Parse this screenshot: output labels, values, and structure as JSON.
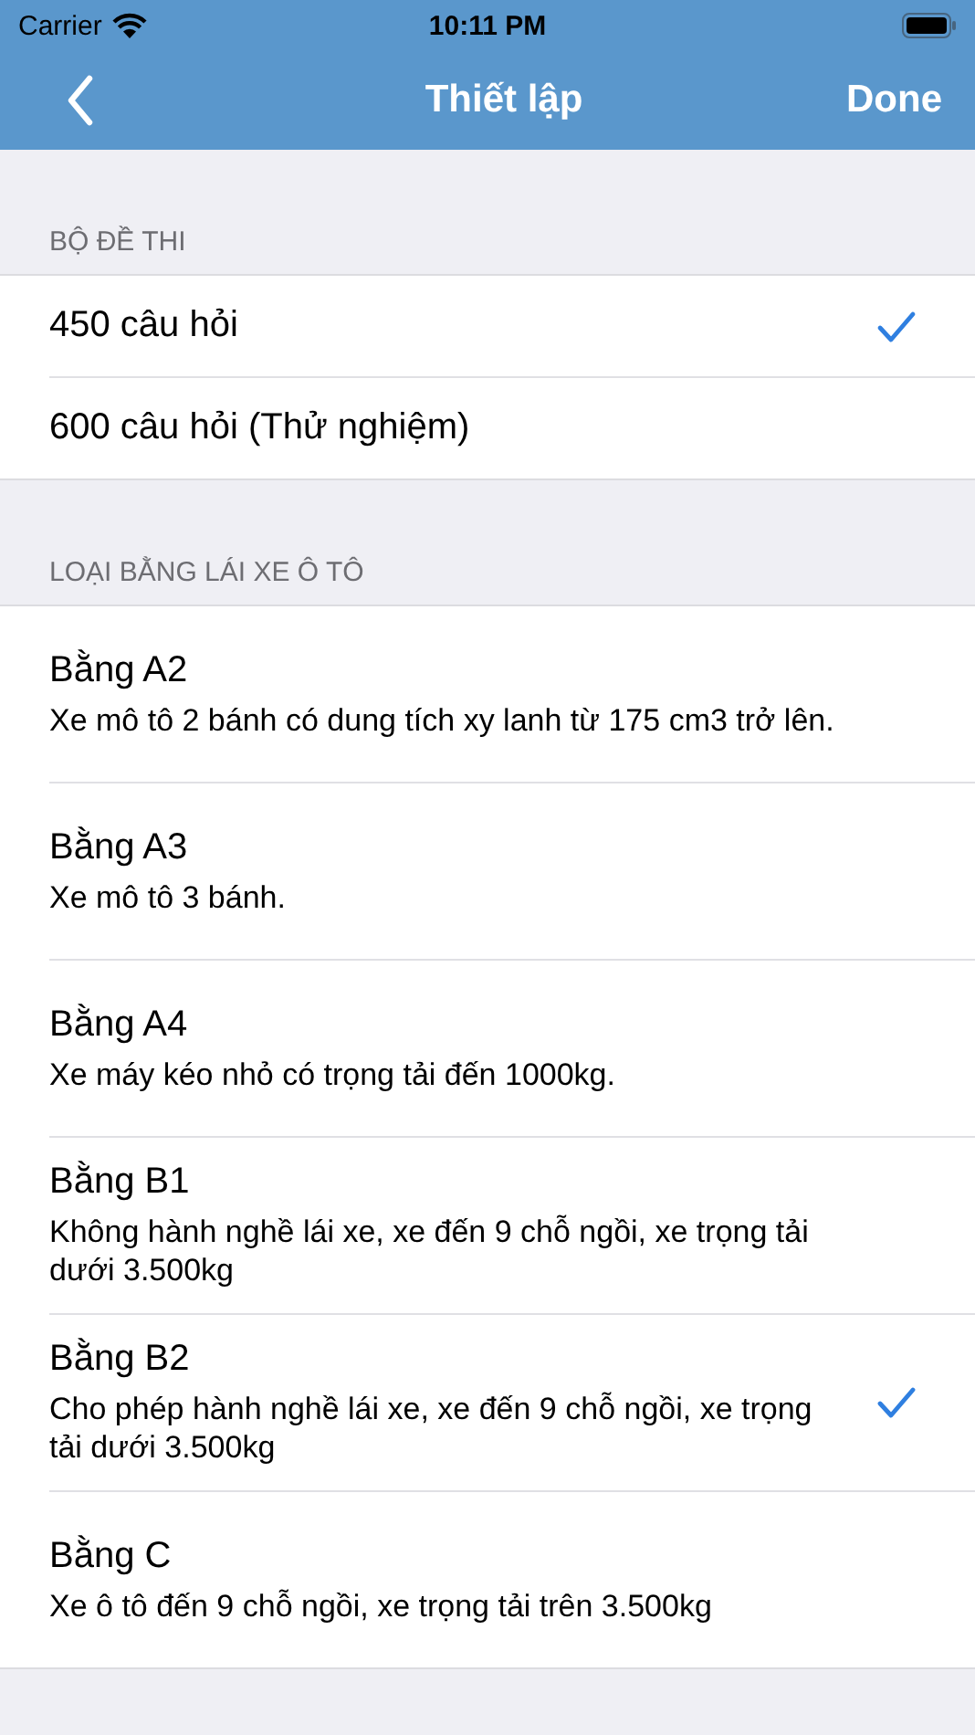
{
  "status_bar": {
    "carrier": "Carrier",
    "time": "10:11 PM"
  },
  "nav": {
    "title": "Thiết lập",
    "done": "Done"
  },
  "sections": [
    {
      "header": "BỘ ĐỀ THI",
      "items": [
        {
          "title": "450 câu hỏi",
          "selected": true
        },
        {
          "title": "600 câu hỏi (Thử nghiệm)",
          "selected": false
        }
      ]
    },
    {
      "header": "LOẠI BẰNG LÁI XE Ô TÔ",
      "items": [
        {
          "title": "Bằng A2",
          "subtitle": "Xe mô tô 2 bánh có dung tích xy lanh từ 175 cm3 trở lên.",
          "selected": false
        },
        {
          "title": "Bằng A3",
          "subtitle": "Xe mô tô 3 bánh.",
          "selected": false
        },
        {
          "title": "Bằng A4",
          "subtitle": "Xe máy kéo nhỏ có trọng tải đến 1000kg.",
          "selected": false
        },
        {
          "title": "Bằng B1",
          "subtitle": "Không hành nghề lái xe, xe đến 9 chỗ ngồi, xe trọng tải dưới 3.500kg",
          "selected": false
        },
        {
          "title": "Bằng B2",
          "subtitle": "Cho phép hành nghề lái xe, xe đến 9 chỗ ngồi, xe trọng tải dưới 3.500kg",
          "selected": true
        },
        {
          "title": "Bằng C",
          "subtitle": "Xe ô tô đến 9 chỗ ngồi, xe trọng tải trên 3.500kg",
          "selected": false
        }
      ]
    }
  ]
}
